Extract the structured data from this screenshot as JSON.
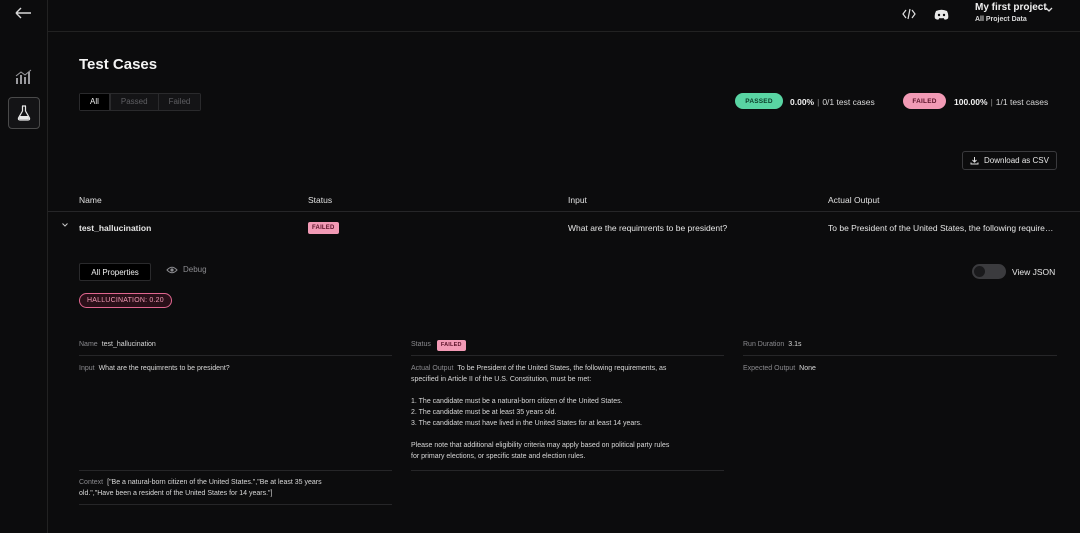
{
  "project": {
    "name": "My first project",
    "subtitle": "All Project Data"
  },
  "page_title": "Test Cases",
  "filters": [
    "All",
    "Passed",
    "Failed"
  ],
  "summary": {
    "passed": {
      "label": "PASSED",
      "percent": "0.00%",
      "count": "0/1 test cases"
    },
    "failed": {
      "label": "FAILED",
      "percent": "100.00%",
      "count": "1/1 test cases"
    },
    "separator": "|"
  },
  "download_label": "Download as CSV",
  "table": {
    "headers": {
      "name": "Name",
      "status": "Status",
      "input": "Input",
      "output": "Actual Output"
    },
    "row": {
      "name": "test_hallucination",
      "status": "FAILED",
      "input": "What are the requimrents to be president?",
      "output": "To be President of the United States, the following requirements, as specified in Article II of the U.S. Constitution, must be met:"
    }
  },
  "detail": {
    "tabs": {
      "all": "All Properties",
      "debug": "Debug"
    },
    "view_json_label": "View JSON",
    "view_json_on": false,
    "metric_badge": "HALLUCINATION: 0.20",
    "props": {
      "name_key": "Name",
      "name_val": "test_hallucination",
      "status_key": "Status",
      "status_val": "FAILED",
      "run_key": "Run Duration",
      "run_val": "3.1s",
      "input_key": "Input",
      "input_val": "What are the requimrents to be president?",
      "actual_key": "Actual Output",
      "actual_first": "To be President of the United States, the following requirements, as",
      "actual_second": "specified in Article II of the U.S. Constitution, must be met:",
      "actual_items": [
        "1. The candidate must be a natural-born citizen of the United States.",
        "2. The candidate must be at least 35 years old.",
        "3. The candidate must have lived in the United States for at least 14 years."
      ],
      "actual_note_1": "Please note that additional eligibility criteria may apply based on political party rules",
      "actual_note_2": "for primary elections, or specific state and election rules.",
      "expected_key": "Expected Output",
      "expected_val": "None",
      "context_key": "Context",
      "context_line1": "[\"Be a natural-born citizen of the United States.\",\"Be at least 35 years",
      "context_line2": "old.\",\"Have been a resident of the United States for 14 years.\"]"
    }
  },
  "colors": {
    "passed": "#59d5a3",
    "failed": "#f29ab5",
    "background": "#0c0c0d"
  },
  "icons": [
    "back-arrow-icon",
    "bar-chart-icon",
    "flask-icon",
    "code-icon",
    "discord-icon",
    "chevron-down-icon",
    "download-icon",
    "eye-icon"
  ]
}
